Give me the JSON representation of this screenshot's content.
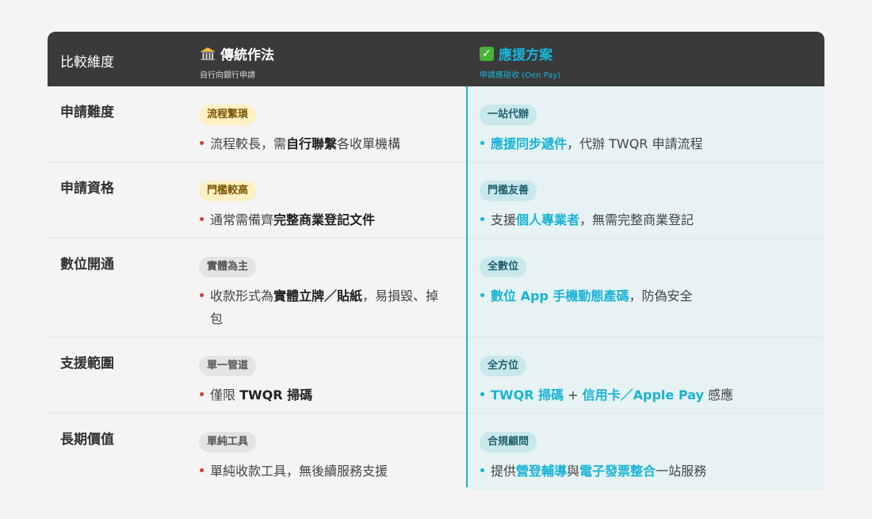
{
  "header": {
    "dimension": "比較維度",
    "traditional": {
      "icon": "bank-icon",
      "title": "傳統作法",
      "subtitle": "自行向銀行申請"
    },
    "recommended": {
      "icon": "check-icon",
      "title": "應援方案",
      "subtitle": "申請應碰收 (Oen Pay)"
    }
  },
  "rows": [
    {
      "dimension": "申請難度",
      "traditional": {
        "badge": "流程繁瑣",
        "badge_color": "#fdf0c2",
        "text": {
          "a": "流程較長，需",
          "b": "自行聯繫",
          "c": "各收單機構"
        }
      },
      "recommended": {
        "badge": "一站代辦",
        "text": {
          "a": "",
          "b": "應援同步遞件",
          "c": "，代辦 TWQR 申請流程"
        }
      }
    },
    {
      "dimension": "申請資格",
      "traditional": {
        "badge": "門檻較高",
        "badge_color": "#fdf0c2",
        "text": {
          "a": "通常需備齊",
          "b": "完整商業登記文件",
          "c": ""
        }
      },
      "recommended": {
        "badge": "門檻友善",
        "text": {
          "a": "支援",
          "b": "個人專業者",
          "c": "，無需完整商業登記"
        }
      }
    },
    {
      "dimension": "數位開通",
      "traditional": {
        "badge": "實體為主",
        "badge_color": "#e4e4e4",
        "text": {
          "a": "收款形式為",
          "b": "實體立牌／貼紙",
          "c": "，易損毀、掉包"
        }
      },
      "recommended": {
        "badge": "全數位",
        "text": {
          "a": "",
          "b": "數位 App 手機動態產碼",
          "c": "，防偽安全"
        }
      }
    },
    {
      "dimension": "支援範圍",
      "traditional": {
        "badge": "單一管道",
        "badge_color": "#e4e4e4",
        "text": {
          "a": "僅限 ",
          "b": "TWQR 掃碼",
          "c": ""
        }
      },
      "recommended": {
        "badge": "全方位",
        "text": {
          "a": "",
          "b": "TWQR 掃碼",
          "c": " + ",
          "d": "信用卡／Apple Pay",
          "e": " 感應"
        }
      }
    },
    {
      "dimension": "長期價值",
      "traditional": {
        "badge": "單純工具",
        "badge_color": "#e4e4e4",
        "text": {
          "a": "單純收款工具，無後續服務支援",
          "b": "",
          "c": ""
        }
      },
      "recommended": {
        "badge": "合規顧問",
        "text": {
          "a": "提供",
          "b": "營登輔導",
          "c": "與",
          "d": "電子發票整合",
          "e": "一站服務"
        }
      }
    }
  ],
  "colors": {
    "accent": "#19b3d6",
    "header_bg": "#3a3a3a",
    "right_column_bg": "#e6f2f3",
    "bullet_traditional": "#d0403a"
  }
}
